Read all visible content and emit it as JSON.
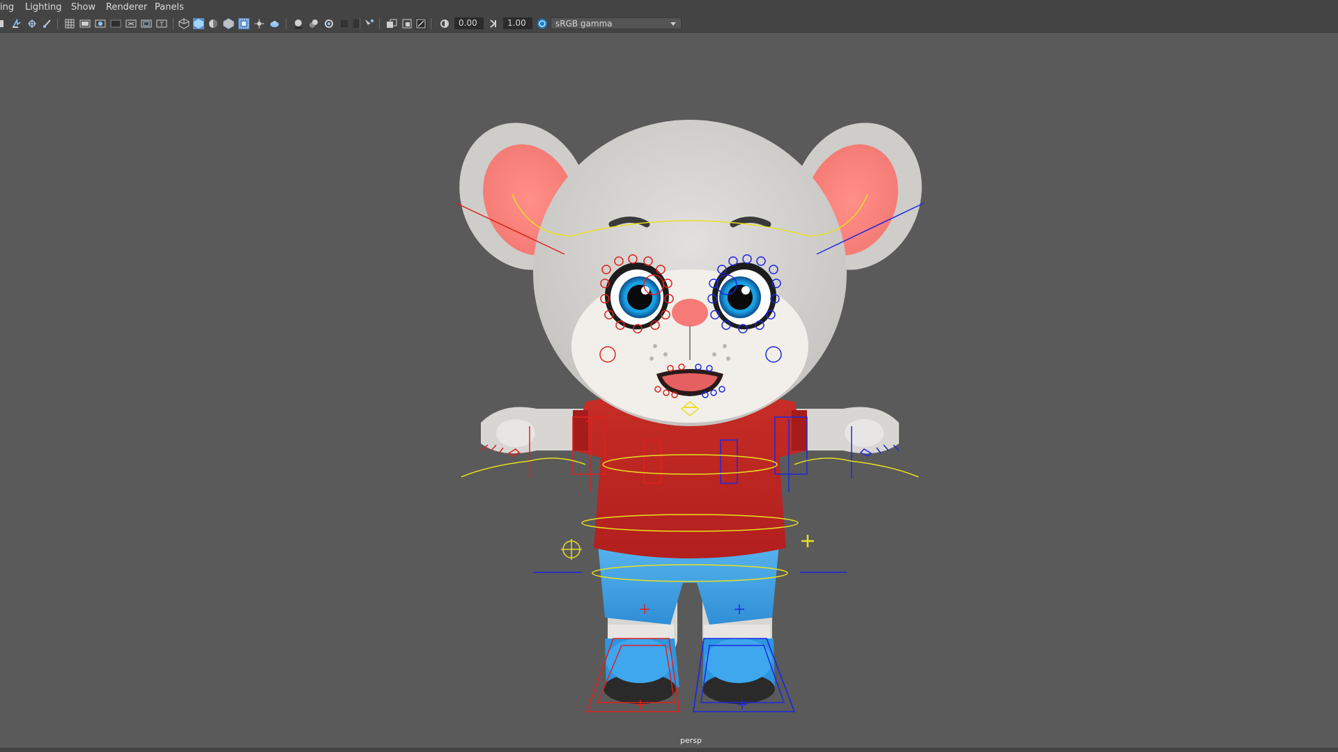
{
  "menubar": {
    "items": [
      "ing",
      "Lighting",
      "Show",
      "Renderer",
      "Panels"
    ]
  },
  "toolbar": {
    "exposure_value": "0.00",
    "gamma_value": "1.00",
    "color_space": "sRGB gamma",
    "icons": [
      "select-camera-icon",
      "camera-attributes-icon",
      "bookmark-icon",
      "image-plane-icon",
      "grid-icon",
      "film-gate-icon",
      "resolution-gate-icon",
      "gate-mask-icon",
      "field-chart-icon",
      "safe-action-icon",
      "safe-title-icon",
      "wireframe-icon",
      "smooth-shade-icon",
      "default-material-icon",
      "wireframe-on-shaded-icon",
      "xray-icon",
      "xray-joints-icon",
      "use-all-lights-icon",
      "shadows-icon",
      "screen-space-ao-icon",
      "motion-blur-icon",
      "anti-aliasing-icon",
      "depth-of-field-icon",
      "isolate-select-icon",
      "textured-icon",
      "backface-culling-icon",
      "high-quality-icon",
      "exposure-icon",
      "gamma-icon",
      "color-management-icon"
    ]
  },
  "viewport": {
    "camera": "persp",
    "background": "#5a5a5a",
    "subject": "cartoon-mouse-character-rig"
  },
  "colors": {
    "left_controls": "#e0201c",
    "right_controls": "#1c28e0",
    "center_controls": "#e8e020",
    "shirt": "#c52424",
    "pants": "#3fa0e0",
    "fur": "#d8d6d2"
  }
}
